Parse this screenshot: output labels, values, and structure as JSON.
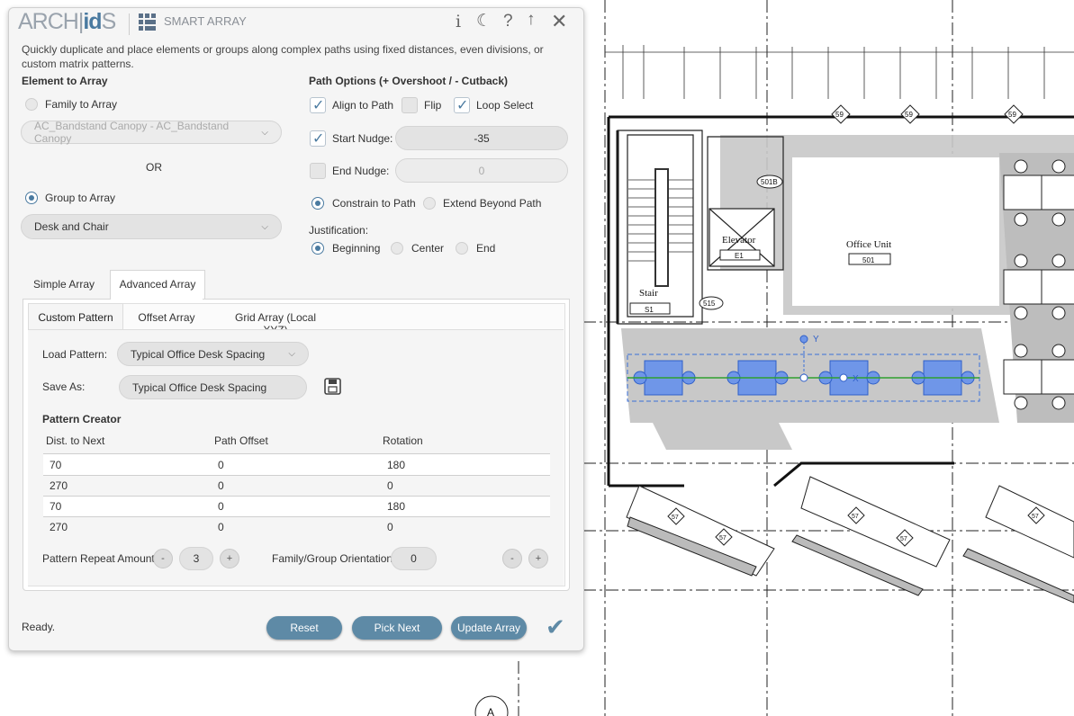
{
  "app": {
    "logo_prefix": "ARCH|",
    "logo_strong": "id",
    "logo_suffix": "S",
    "title": "SMART ARRAY",
    "description": "Quickly duplicate and place elements or groups along complex paths using fixed distances, even divisions, or custom matrix patterns.",
    "header_icons": [
      "info-icon",
      "moon-icon",
      "help-icon",
      "arrow-up-icon",
      "close-icon"
    ]
  },
  "element": {
    "heading": "Element to Array",
    "family_label": "Family to Array",
    "family_value": "AC_Bandstand Canopy - AC_Bandstand Canopy",
    "or_label": "OR",
    "group_label": "Group to Array",
    "group_value": "Desk and Chair"
  },
  "path_options": {
    "heading": "Path Options (+ Overshoot / - Cutback)",
    "align_label": "Align to Path",
    "align_checked": true,
    "flip_label": "Flip",
    "flip_checked": false,
    "loop_label": "Loop Select",
    "loop_checked": true,
    "start_nudge_label": "Start Nudge:",
    "start_nudge_checked": true,
    "start_nudge_value": "-35",
    "end_nudge_label": "End Nudge:",
    "end_nudge_checked": false,
    "end_nudge_value": "0",
    "constrain_label": "Constrain to Path",
    "extend_label": "Extend Beyond Path",
    "justification_label": "Justification:",
    "just_beginning": "Beginning",
    "just_center": "Center",
    "just_end": "End"
  },
  "tabs": {
    "simple": "Simple Array",
    "advanced": "Advanced Array",
    "custom": "Custom Pattern",
    "offset": "Offset Array",
    "grid": "Grid Array (Local XYZ)"
  },
  "pattern": {
    "load_label": "Load Pattern:",
    "load_value": "Typical Office Desk Spacing",
    "save_label": "Save As:",
    "save_value": "Typical Office Desk Spacing",
    "creator_heading": "Pattern Creator",
    "columns": [
      "Dist. to Next",
      "Path Offset",
      "Rotation"
    ],
    "rows": [
      [
        "70",
        "0",
        "180"
      ],
      [
        "270",
        "0",
        "0"
      ],
      [
        "70",
        "0",
        "180"
      ],
      [
        "270",
        "0",
        "0"
      ]
    ],
    "repeat_label": "Pattern Repeat Amount:",
    "repeat_value": "3",
    "minus": "-",
    "plus": "+",
    "orientation_label": "Family/Group Orientation:",
    "orientation_value": "0"
  },
  "footer": {
    "status": "Ready.",
    "reset": "Reset",
    "pick_next": "Pick Next",
    "update": "Update Array"
  },
  "drawing": {
    "tags_59": "59",
    "tag_501b": "501B",
    "elevator_label": "Elevator",
    "elevator_tag": "E1",
    "office_label": "Office Unit",
    "office_tag": "501",
    "stair_label": "Stair",
    "stair_tag": "S1",
    "tag_515": "515",
    "tag_57": "57",
    "axis_y": "Y",
    "axis_x": "X",
    "grid_bubble": "A",
    "colors": {
      "selection": "#3a6fd8",
      "path": "#2fa02f"
    }
  }
}
